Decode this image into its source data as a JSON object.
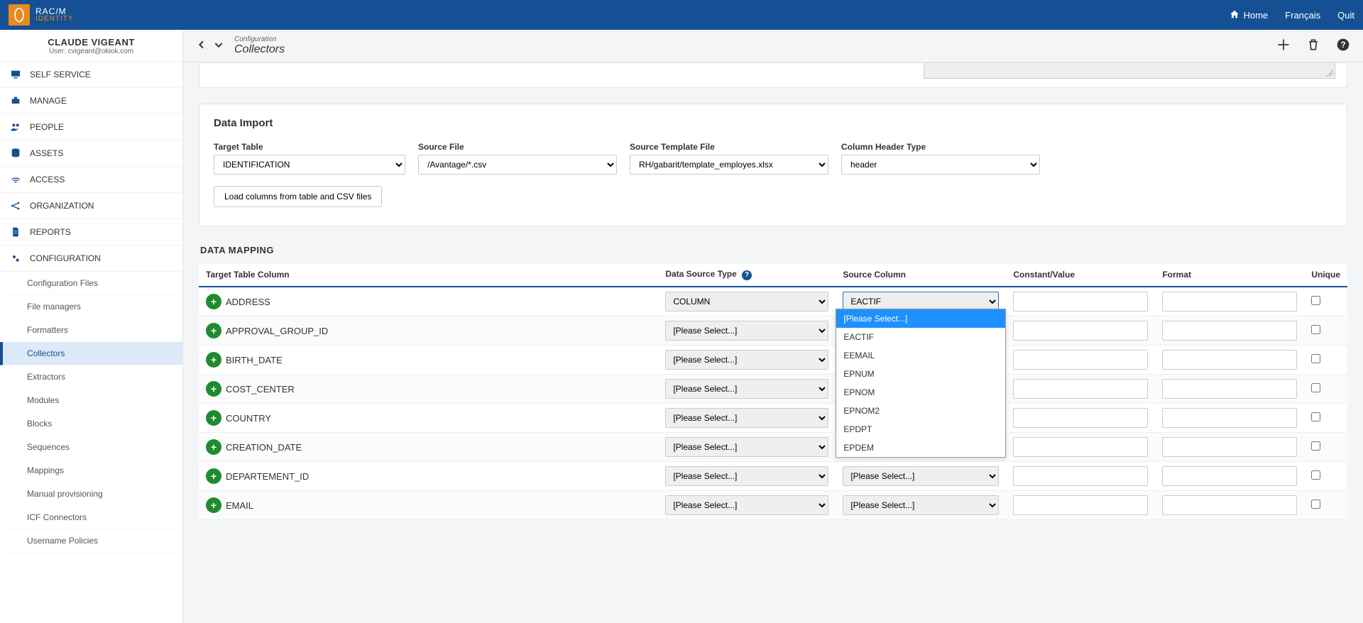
{
  "header": {
    "brand_line1": "RAC/M",
    "brand_line2": "IDENTITY",
    "home_label": "Home",
    "lang_label": "Français",
    "quit_label": "Quit"
  },
  "user": {
    "name": "CLAUDE VIGEANT",
    "sub": "User: cvigeant@okiok.com"
  },
  "sidebar": {
    "items": [
      {
        "label": "SELF SERVICE"
      },
      {
        "label": "MANAGE"
      },
      {
        "label": "PEOPLE"
      },
      {
        "label": "ASSETS"
      },
      {
        "label": "ACCESS"
      },
      {
        "label": "ORGANIZATION"
      },
      {
        "label": "REPORTS"
      },
      {
        "label": "CONFIGURATION"
      }
    ],
    "config_children": [
      {
        "label": "Configuration Files"
      },
      {
        "label": "File managers"
      },
      {
        "label": "Formatters"
      },
      {
        "label": "Collectors",
        "active": true
      },
      {
        "label": "Extractors"
      },
      {
        "label": "Modules"
      },
      {
        "label": "Blocks"
      },
      {
        "label": "Sequences"
      },
      {
        "label": "Mappings"
      },
      {
        "label": "Manual provisioning"
      },
      {
        "label": "ICF Connectors"
      },
      {
        "label": "Username Policies"
      }
    ]
  },
  "main_head": {
    "supertitle": "Configuration",
    "title": "Collectors"
  },
  "import_card": {
    "title": "Data Import",
    "target_table_label": "Target Table",
    "target_table_value": "IDENTIFICATION",
    "source_file_label": "Source File",
    "source_file_value": "/Avantage/*.csv",
    "template_label": "Source Template File",
    "template_value": "RH/gabarit/template_employes.xlsx",
    "header_type_label": "Column Header Type",
    "header_type_value": "header",
    "load_btn": "Load columns from table and CSV files"
  },
  "mapping": {
    "section_title": "DATA MAPPING",
    "th_target": "Target Table Column",
    "th_ds": "Data Source Type",
    "th_src": "Source Column",
    "th_const": "Constant/Value",
    "th_fmt": "Format",
    "th_unique": "Unique",
    "please_select": "[Please Select...]",
    "rows": [
      {
        "target": "ADDRESS",
        "ds": "COLUMN",
        "src": "EACTIF",
        "open": true
      },
      {
        "target": "APPROVAL_GROUP_ID"
      },
      {
        "target": "BIRTH_DATE"
      },
      {
        "target": "COST_CENTER"
      },
      {
        "target": "COUNTRY"
      },
      {
        "target": "CREATION_DATE"
      },
      {
        "target": "DEPARTEMENT_ID"
      },
      {
        "target": "EMAIL"
      }
    ],
    "dropdown_options": [
      "[Please Select...]",
      "EACTIF",
      "EEMAIL",
      "EPNUM",
      "EPNOM",
      "EPNOM2",
      "EPDPT",
      "EPDEM"
    ]
  }
}
